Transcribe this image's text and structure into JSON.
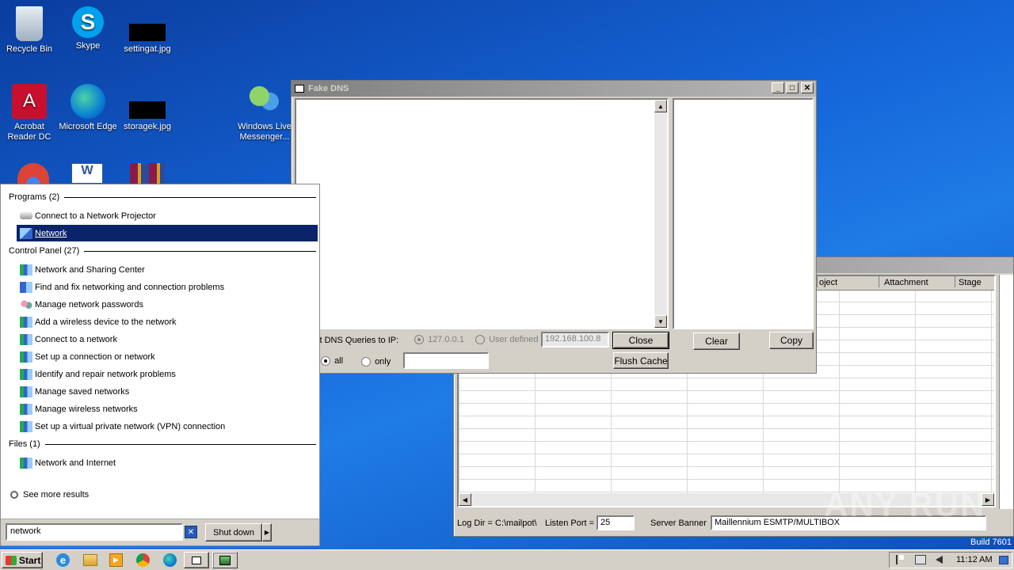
{
  "desktop": {
    "icons": [
      {
        "label": "Recycle Bin",
        "icon": "recycle-bin-icon"
      },
      {
        "label": "Skype",
        "icon": "skype-icon"
      },
      {
        "label": "settingat.jpg",
        "icon": "image-file-icon"
      },
      {
        "label": "Acrobat Reader DC",
        "icon": "acrobat-icon"
      },
      {
        "label": "Microsoft Edge",
        "icon": "edge-icon"
      },
      {
        "label": "storagek.jpg",
        "icon": "image-file-icon"
      },
      {
        "label": "Windows Live Messenger...",
        "icon": "messenger-icon"
      }
    ],
    "build": "Build 7601",
    "watermark": "ANY RUN"
  },
  "fake_dns": {
    "title": "Fake DNS",
    "redirect_label": "ct DNS Queries to IP:",
    "radio_local": "127.0.0.1",
    "radio_user": "User defined",
    "ip_value": "192.168.100.8",
    "close_label": "Close",
    "flush_label": "Flush Cache",
    "all_label": "all",
    "only_label": "only",
    "only_value": "",
    "clear_label": "Clear",
    "copy_label": "Copy"
  },
  "mailpot": {
    "columns": [
      "oject",
      "Attachment",
      "Stage"
    ],
    "log_dir": "Log Dir = C:\\mailpot\\",
    "listen_port_label": "Listen Port =",
    "listen_port_value": "25",
    "server_banner_label": "Server Banner",
    "server_banner_value": "Maillennium ESMTP/MULTIBOX"
  },
  "start_menu": {
    "programs_header": "Programs (2)",
    "programs": [
      {
        "label": "Connect to a Network Projector",
        "icon": "projector-icon"
      },
      {
        "label": "Network",
        "icon": "network-icon",
        "selected": true
      }
    ],
    "control_header": "Control Panel (27)",
    "control": [
      {
        "label": "Network and Sharing Center",
        "icon": "network-center-icon"
      },
      {
        "label": "Find and fix networking and connection problems",
        "icon": "troubleshoot-icon"
      },
      {
        "label": "Manage network passwords",
        "icon": "users-icon"
      },
      {
        "label": "Add a wireless device to the network",
        "icon": "network-center-icon"
      },
      {
        "label": "Connect to a network",
        "icon": "network-center-icon"
      },
      {
        "label": "Set up a connection or network",
        "icon": "network-center-icon"
      },
      {
        "label": "Identify and repair network problems",
        "icon": "network-center-icon"
      },
      {
        "label": "Manage saved networks",
        "icon": "network-center-icon"
      },
      {
        "label": "Manage wireless networks",
        "icon": "network-center-icon"
      },
      {
        "label": "Set up a virtual private network (VPN) connection",
        "icon": "network-center-icon"
      }
    ],
    "files_header": "Files (1)",
    "files": [
      {
        "label": "Network and Internet",
        "icon": "network-center-icon"
      }
    ],
    "see_more": "See more results",
    "search_value": "network",
    "shutdown_label": "Shut down"
  },
  "taskbar": {
    "start_label": "Start",
    "clock": "11:12 AM"
  }
}
